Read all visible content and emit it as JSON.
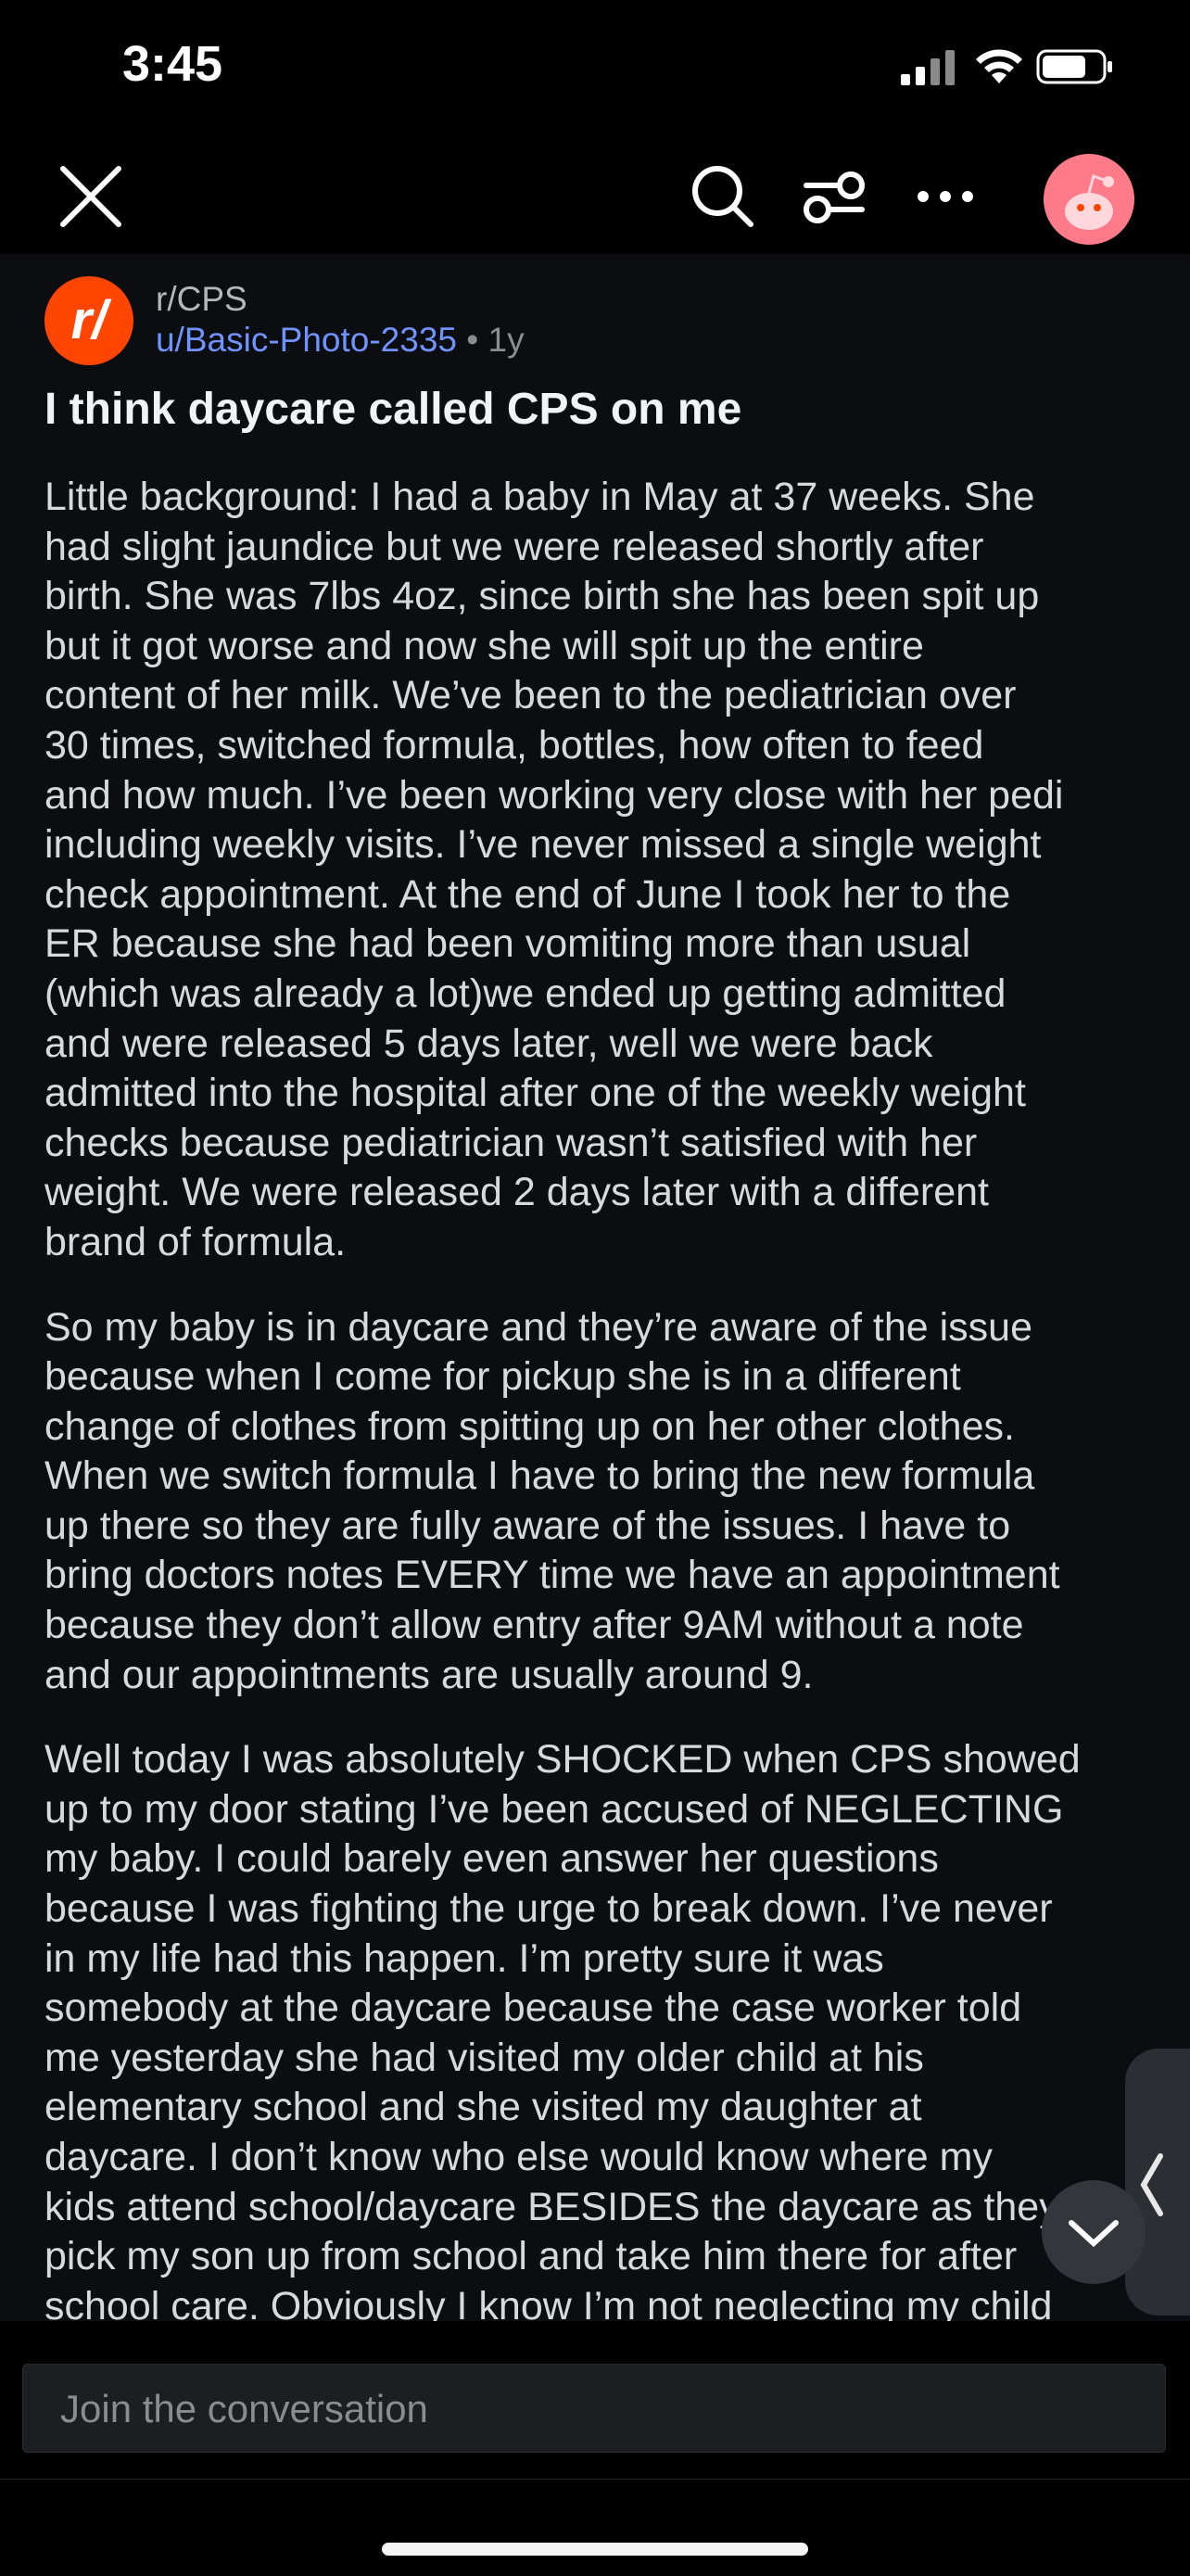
{
  "status_bar": {
    "time": "3:45"
  },
  "nav": {
    "close_icon": "close-icon",
    "search_icon": "search-icon",
    "filter_icon": "filter-icon",
    "more_icon": "more-icon",
    "avatar_icon": "avatar-icon"
  },
  "post": {
    "subreddit": "r/CPS",
    "subreddit_icon_text": "r/",
    "author": "u/Basic-Photo-2335",
    "separator": "•",
    "age": "1y",
    "title": "I think daycare called CPS on me",
    "paragraphs": [
      "Little background: I had a baby in May at 37 weeks. She\nhad slight jaundice but we were released shortly after\nbirth. She was 7lbs 4oz, since birth she has been spit up\nbut it got worse and now she will spit up the entire\ncontent of her milk. We’ve been to the pediatrician over\n30 times, switched formula, bottles, how often to feed\nand how much. I’ve been working very close with her pedi\nincluding weekly visits. I’ve never missed a single weight\ncheck appointment. At the end of June I took her to the\nER because she had been vomiting more than usual\n(which was already a lot)we ended up getting admitted\nand were released 5 days later, well we were back\nadmitted into the hospital after one of the weekly weight\nchecks because pediatrician wasn’t satisfied with her\nweight. We were released 2 days later with a different\nbrand of formula.",
      "So my baby is in daycare and they’re aware of the issue\nbecause when I come for pickup she is in a different\nchange of clothes from spitting up on her other clothes.\nWhen we switch formula I have to bring the new formula\nup there so they are fully aware of the issues. I have to\nbring doctors notes EVERY time we have an appointment\nbecause they don’t allow entry after 9AM without a note\nand our appointments are usually around 9.",
      "Well today I was absolutely SHOCKED when CPS showed\nup to my door stating I’ve been accused of NEGLECTING\nmy baby. I could barely even answer her questions\nbecause I was fighting the urge to break down. I’ve never\nin my life had this happen. I’m pretty sure it was\nsomebody at the daycare because the case worker told\nme yesterday she had visited my older child at his\nelementary school and she visited my daughter at\ndaycare. I don’t know who else would know where my\nkids attend school/daycare BESIDES the daycare as they\npick my son up from school and take him there for after\nschool care. Obviously I know I’m not neglecting my child"
    ]
  },
  "composer": {
    "placeholder": "Join the conversation"
  },
  "colors": {
    "accent": "#ff4500",
    "author": "#7193ff",
    "background": "#0b0d10"
  }
}
